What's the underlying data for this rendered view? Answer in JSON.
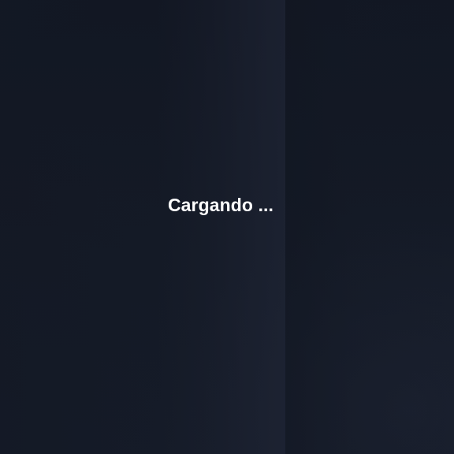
{
  "loading": {
    "message": "Cargando ..."
  },
  "colors": {
    "background": "#131824",
    "text": "#ffffff"
  }
}
